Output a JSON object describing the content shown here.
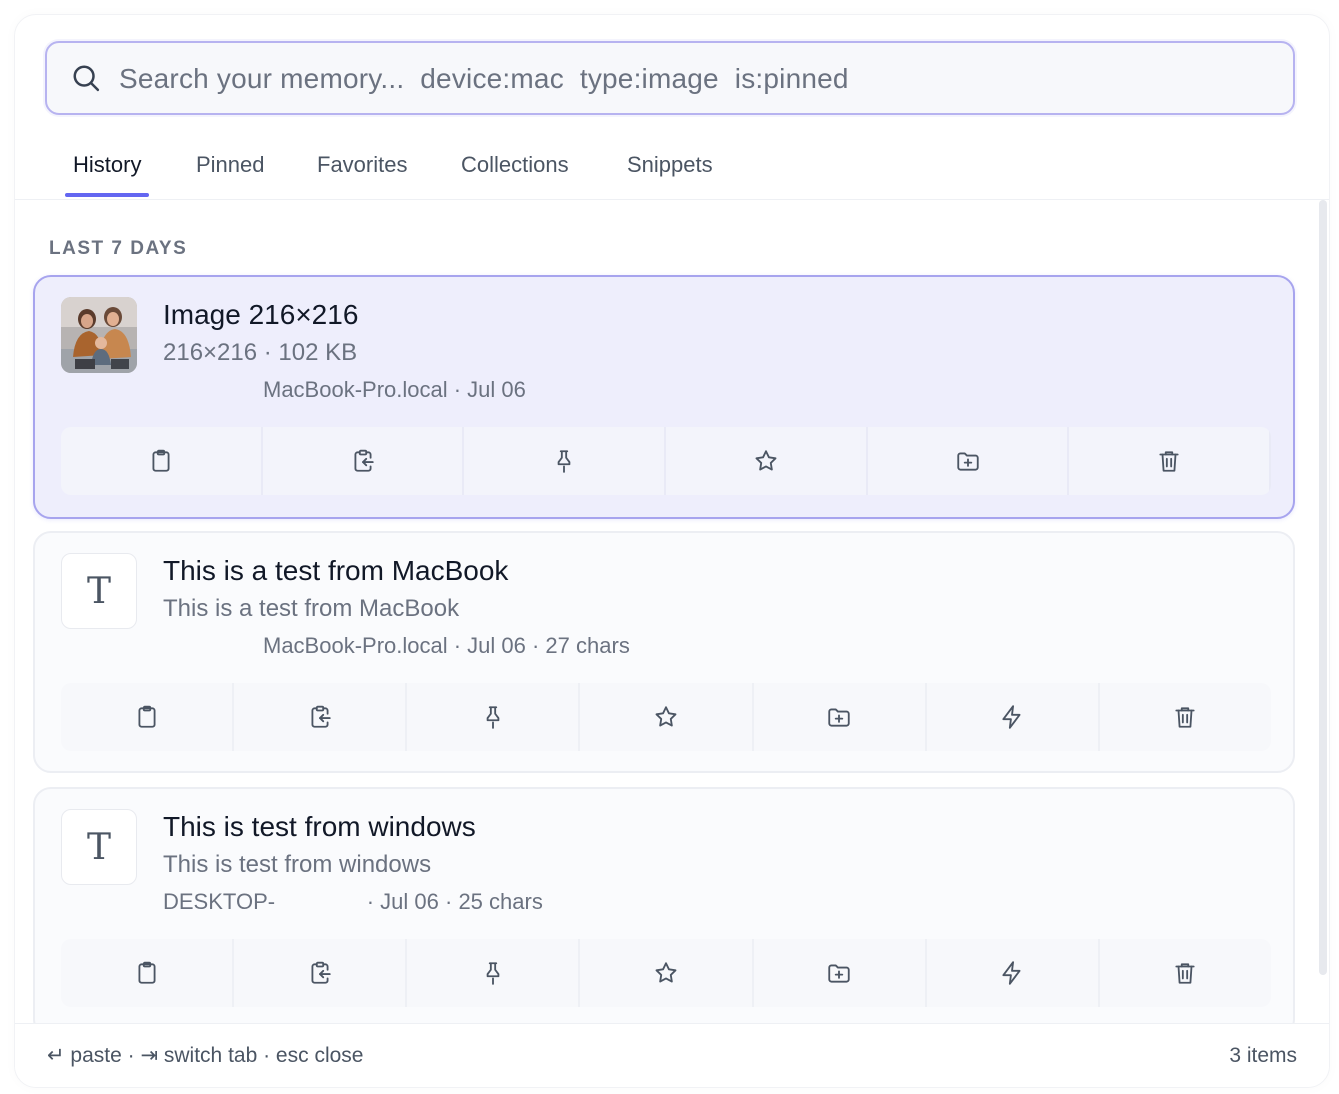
{
  "search": {
    "placeholder": "Search your memory...  device:mac  type:image  is:pinned"
  },
  "tabs": [
    {
      "label": "History",
      "active": true
    },
    {
      "label": "Pinned",
      "active": false
    },
    {
      "label": "Favorites",
      "active": false
    },
    {
      "label": "Collections",
      "active": false
    },
    {
      "label": "Snippets",
      "active": false
    }
  ],
  "section": {
    "label": "LAST 7 DAYS"
  },
  "items": [
    {
      "kind": "image",
      "title": "Image 216×216",
      "subtitle": "216×216 · 102 KB",
      "meta": "MacBook-Pro.local · Jul 06",
      "selected": true,
      "actions": [
        "clipboard-icon",
        "paste-icon",
        "pin-icon",
        "star-icon",
        "folder-add-icon",
        "trash-icon"
      ]
    },
    {
      "kind": "text",
      "glyph": "T",
      "title": "This is a test from MacBook",
      "subtitle": "This is a test from MacBook",
      "meta": "MacBook-Pro.local · Jul 06 · 27 chars",
      "selected": false,
      "actions": [
        "clipboard-icon",
        "paste-icon",
        "pin-icon",
        "star-icon",
        "folder-add-icon",
        "bolt-icon",
        "trash-icon"
      ]
    },
    {
      "kind": "text",
      "glyph": "T",
      "title": "This is test from windows",
      "subtitle": "This is test from windows",
      "meta": "DESKTOP-               · Jul 06 · 25 chars",
      "selected": false,
      "actions": [
        "clipboard-icon",
        "paste-icon",
        "pin-icon",
        "star-icon",
        "folder-add-icon",
        "bolt-icon",
        "trash-icon"
      ]
    }
  ],
  "footer": {
    "hints": "↵ paste · ⇥ switch tab · esc close",
    "count": "3 items"
  },
  "colors": {
    "accent": "#6366f1",
    "selected_bg": "#eeeefc",
    "selected_border": "#a7a4ee"
  }
}
